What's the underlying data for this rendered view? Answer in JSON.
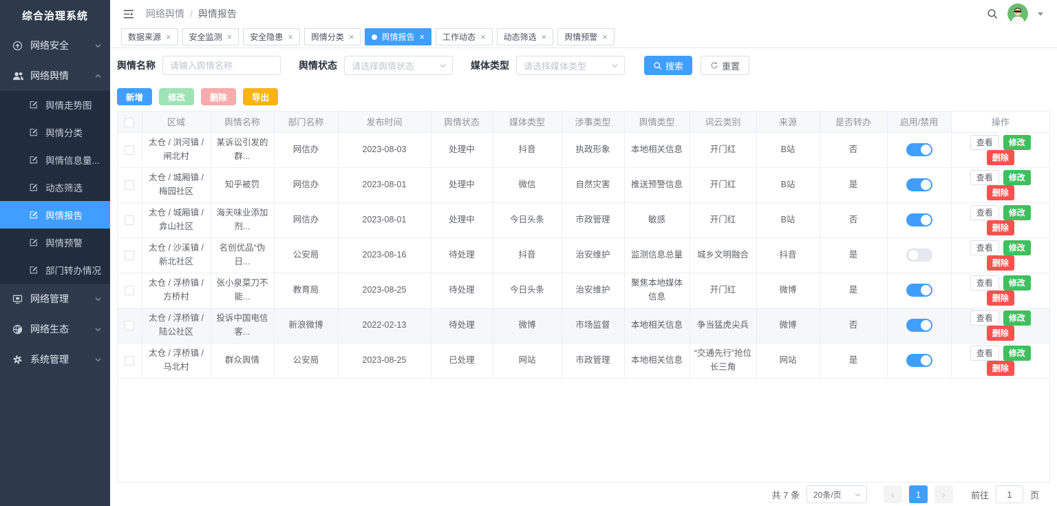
{
  "app": {
    "title": "综合治理系统"
  },
  "colors": {
    "accent": "#409eff",
    "sidebar_bg": "#2d3a4b",
    "submenu_bg": "#212c3c",
    "success_green": "#3fc05f",
    "danger_red": "#f9514e",
    "export_yellow": "#fbb40f"
  },
  "sidebar": {
    "title": "综合治理系统",
    "items": [
      {
        "key": "network-security",
        "label": "网络安全",
        "icon": "upload-circle-icon",
        "state": "collapsed"
      },
      {
        "key": "network-opinion",
        "label": "网络舆情",
        "icon": "users-icon",
        "state": "expanded",
        "children": [
          {
            "key": "opinion-trend",
            "label": "舆情走势图"
          },
          {
            "key": "opinion-category",
            "label": "舆情分类"
          },
          {
            "key": "opinion-info-volume",
            "label": "舆情信息量..."
          },
          {
            "key": "dynamic-filter",
            "label": "动态筛选"
          },
          {
            "key": "opinion-report",
            "label": "舆情报告",
            "active": true
          },
          {
            "key": "opinion-warning",
            "label": "舆情预警"
          },
          {
            "key": "department-transfer",
            "label": "部门转办情况"
          }
        ]
      },
      {
        "key": "network-management",
        "label": "网络管理",
        "icon": "monitor-icon",
        "state": "collapsed"
      },
      {
        "key": "network-ecology",
        "label": "网络生态",
        "icon": "globe-icon",
        "state": "collapsed"
      },
      {
        "key": "system-management",
        "label": "系统管理",
        "icon": "gear-icon",
        "state": "collapsed"
      }
    ]
  },
  "header": {
    "breadcrumb": [
      "网络舆情",
      "舆情报告"
    ],
    "separator": "/"
  },
  "tabs": [
    {
      "key": "data-source",
      "label": "数据来源"
    },
    {
      "key": "security-monitor",
      "label": "安全监测"
    },
    {
      "key": "security-risk",
      "label": "安全隐患"
    },
    {
      "key": "opinion-category",
      "label": "舆情分类"
    },
    {
      "key": "opinion-report",
      "label": "舆情报告",
      "active": true
    },
    {
      "key": "work-dynamic",
      "label": "工作动态"
    },
    {
      "key": "dynamic-filter",
      "label": "动态筛选"
    },
    {
      "key": "opinion-warning",
      "label": "舆情预警"
    }
  ],
  "filters": {
    "name_label": "舆情名称",
    "name_placeholder": "请输入舆情名称",
    "status_label": "舆情状态",
    "status_placeholder": "请选择舆情状态",
    "media_label": "媒体类型",
    "media_placeholder": "请选择媒体类型",
    "search_label": "搜索",
    "reset_label": "重置"
  },
  "actions": {
    "add": "新增",
    "edit": "修改",
    "delete": "删除",
    "export": "导出"
  },
  "table": {
    "columns": [
      "区域",
      "舆情名称",
      "部门名称",
      "发布时间",
      "舆情状态",
      "媒体类型",
      "涉事类型",
      "舆情类型",
      "词云类别",
      "来源",
      "是否转办",
      "启用/禁用",
      "操作"
    ],
    "row_actions": [
      {
        "key": "view",
        "label": "查看"
      },
      {
        "key": "edit",
        "label": "修改"
      },
      {
        "key": "delete",
        "label": "删除"
      }
    ],
    "rows": [
      {
        "region": "太仓 / 浏河镇 / 闸北村",
        "name": "某诉讼引发的群...",
        "department": "网信办",
        "publish_date": "2023-08-03",
        "status": "处理中",
        "media": "抖音",
        "incident_type": "执政形象",
        "opinion_type": "本地相关信息",
        "wordcloud": "开门红",
        "source": "B站",
        "transferred": "否",
        "enabled": true
      },
      {
        "region": "太仓 / 城厢镇 / 梅园社区",
        "name": "知乎被罚",
        "department": "网信办",
        "publish_date": "2023-08-01",
        "status": "处理中",
        "media": "微信",
        "incident_type": "自然灾害",
        "opinion_type": "推送预警信息",
        "wordcloud": "开门红",
        "source": "B站",
        "transferred": "是",
        "enabled": true
      },
      {
        "region": "太仓 / 城厢镇 / 弇山社区",
        "name": "海天味业添加剂...",
        "department": "网信办",
        "publish_date": "2023-08-01",
        "status": "处理中",
        "media": "今日头条",
        "incident_type": "市政管理",
        "opinion_type": "敏感",
        "wordcloud": "开门红",
        "source": "B站",
        "transferred": "否",
        "enabled": true
      },
      {
        "region": "太仓 / 沙溪镇 / 新北社区",
        "name": "名创优品“伪日...",
        "department": "公安局",
        "publish_date": "2023-08-16",
        "status": "待处理",
        "media": "抖音",
        "incident_type": "治安维护",
        "opinion_type": "监测信息总量",
        "wordcloud": "城乡文明融合",
        "source": "抖音",
        "transferred": "是",
        "enabled": false
      },
      {
        "region": "太仓 / 浮桥镇 / 方桥村",
        "name": "张小泉菜刀不能...",
        "department": "教育局",
        "publish_date": "2023-08-25",
        "status": "待处理",
        "media": "今日头条",
        "incident_type": "治安维护",
        "opinion_type": "聚焦本地媒体信息",
        "wordcloud": "开门红",
        "source": "微博",
        "transferred": "是",
        "enabled": true
      },
      {
        "region": "太仓 / 浮桥镇 / 陆公社区",
        "name": "投诉中国电信客...",
        "department": "新浪微博",
        "publish_date": "2022-02-13",
        "status": "待处理",
        "media": "微博",
        "incident_type": "市场监督",
        "opinion_type": "本地相关信息",
        "wordcloud": "争当猛虎尖兵",
        "source": "微博",
        "transferred": "否",
        "enabled": true,
        "highlighted": true
      },
      {
        "region": "太仓 / 浮桥镇 / 马北村",
        "name": "群众舆情",
        "department": "公安局",
        "publish_date": "2023-08-25",
        "status": "已处理",
        "media": "网站",
        "incident_type": "市政管理",
        "opinion_type": "本地相关信息",
        "wordcloud": "“交通先行”抢位长三角",
        "source": "网站",
        "transferred": "是",
        "enabled": true
      }
    ]
  },
  "pagination": {
    "total": "共 7 条",
    "page_size": "20条/页",
    "current_page": "1",
    "goto_label": "前往",
    "goto_value": "1",
    "page_unit": "页"
  }
}
